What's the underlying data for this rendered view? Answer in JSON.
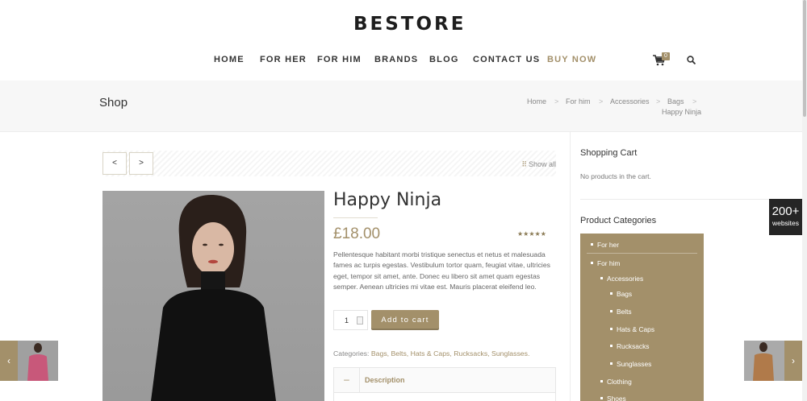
{
  "brand": {
    "logo_text": "BESTORE",
    "accent_color": "#a3906a"
  },
  "nav": {
    "items": [
      {
        "label": "HOME"
      },
      {
        "label": "FOR HER"
      },
      {
        "label": "FOR HIM"
      },
      {
        "label": "BRANDS"
      },
      {
        "label": "BLOG"
      },
      {
        "label": "CONTACT US"
      },
      {
        "label": "BUY NOW"
      }
    ],
    "cart_count": "0",
    "cart_icon": "cart-icon",
    "search_icon": "search-icon"
  },
  "titlebar": {
    "title": "Shop",
    "breadcrumb": [
      "Home",
      "For him",
      "Accessories",
      "Bags",
      "Happy Ninja"
    ],
    "separator": ">"
  },
  "product_nav": {
    "prev_label": "<",
    "next_label": ">",
    "show_all_icon": "grid-icon",
    "show_all_label": "Show all"
  },
  "product": {
    "title": "Happy Ninja",
    "price": "£18.00",
    "rating_stars": "★★★★★",
    "rating": 5,
    "description": "Pellentesque habitant morbi tristique senectus et netus et malesuada fames ac turpis egestas. Vestibulum tortor quam, feugiat vitae, ultricies eget, tempor sit amet, ante. Donec eu libero sit amet quam egestas semper. Aenean ultricies mi vitae est. Mauris placerat eleifend leo.",
    "quantity": "1",
    "add_to_cart_label": "Add to cart",
    "categories_label": "Categories:",
    "categories": "Bags, Belts, Hats & Caps, Rucksacks, Sunglasses.",
    "tab_toggle": "–",
    "tab_label": "Description"
  },
  "sidebar": {
    "cart_title": "Shopping Cart",
    "cart_text": "No products in the cart.",
    "categories_title": "Product Categories",
    "categories": [
      "For her",
      "For him",
      "Accessories",
      "Bags",
      "Belts",
      "Hats & Caps",
      "Rucksacks",
      "Sunglasses",
      "Clothing",
      "Shoes"
    ]
  },
  "widget": {
    "count": "200+",
    "label": "websites"
  },
  "side_nav": {
    "prev_arrow": "‹",
    "next_arrow": "›"
  }
}
